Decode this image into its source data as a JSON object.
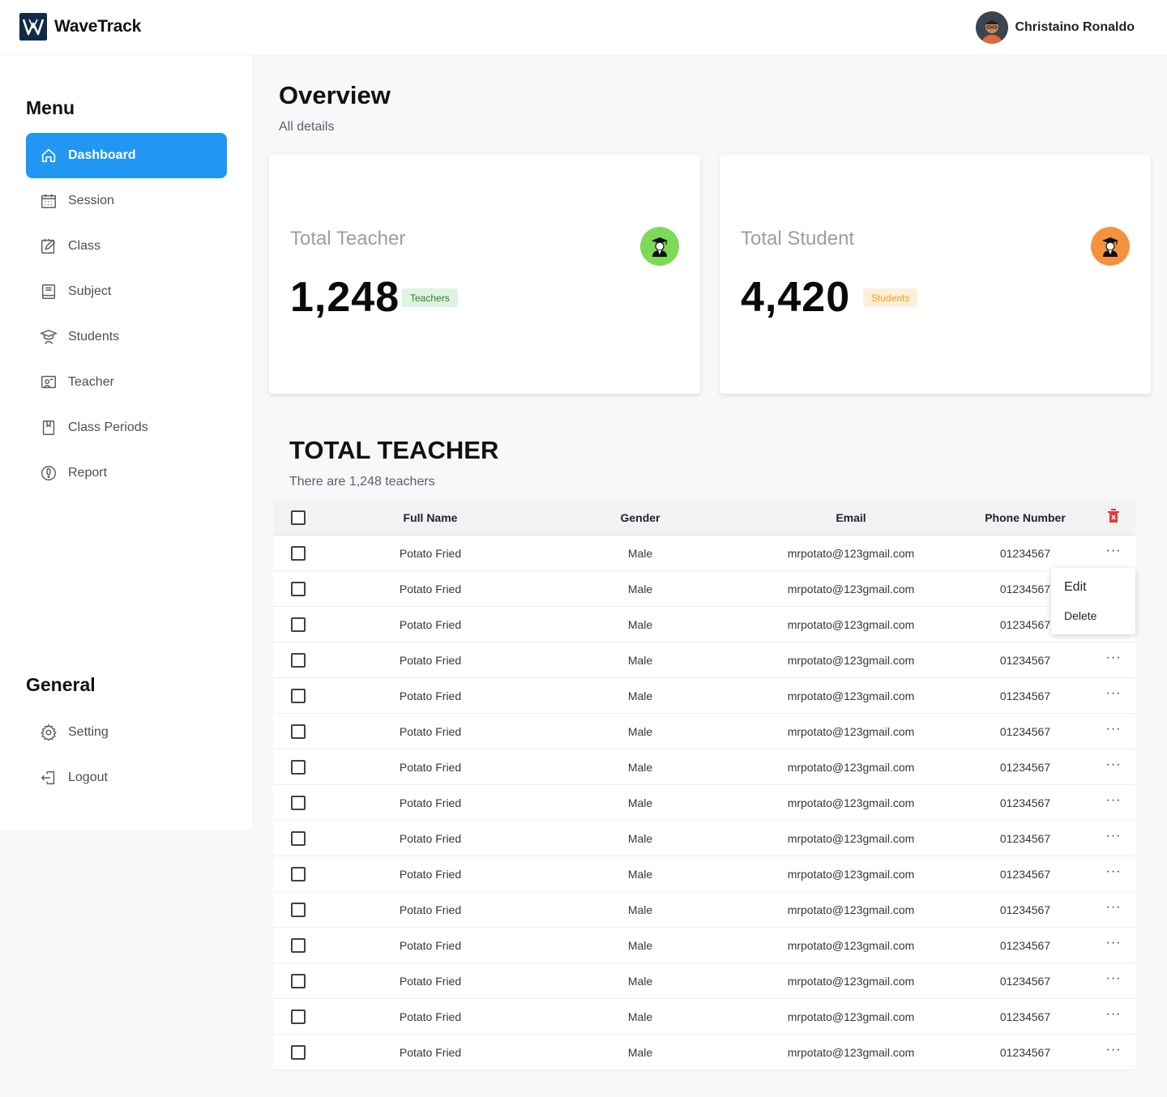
{
  "header": {
    "brand": "WaveTrack",
    "user_name": "Christaino Ronaldo"
  },
  "sidebar": {
    "menu_heading": "Menu",
    "items": [
      {
        "label": "Dashboard",
        "icon": "home-icon",
        "active": true
      },
      {
        "label": "Session",
        "icon": "calendar-icon"
      },
      {
        "label": "Class",
        "icon": "edit-note-icon"
      },
      {
        "label": "Subject",
        "icon": "book-icon"
      },
      {
        "label": "Students",
        "icon": "graduate-icon"
      },
      {
        "label": "Teacher",
        "icon": "teacher-board-icon"
      },
      {
        "label": "Class Periods",
        "icon": "bookmark-icon"
      },
      {
        "label": "Report",
        "icon": "alert-icon"
      }
    ],
    "general_heading": "General",
    "general_items": [
      {
        "label": "Setting",
        "icon": "gear-icon"
      },
      {
        "label": "Logout",
        "icon": "logout-icon"
      }
    ]
  },
  "overview": {
    "title": "Overview",
    "subtitle": "All details"
  },
  "cards": [
    {
      "label": "Total Teacher",
      "value": "1,248",
      "badge": "Teachers",
      "badge_bg": "#dff3e1",
      "badge_color": "#2e7d32",
      "icon_bg": "#7ed957"
    },
    {
      "label": "Total Student",
      "value": "4,420",
      "badge": "Students",
      "badge_bg": "#fdf0d7",
      "badge_color": "#f0a020",
      "icon_bg": "#f5923e"
    }
  ],
  "teacher_table": {
    "title": "TOTAL TEACHER",
    "subtitle": "There are 1,248 teachers",
    "columns": [
      "Full Name",
      "Gender",
      "Email",
      "Phone Number"
    ],
    "rows": [
      {
        "name": "Potato Fried",
        "gender": "Male",
        "email": "mrpotato@123gmail.com",
        "phone": "01234567"
      },
      {
        "name": "Potato Fried",
        "gender": "Male",
        "email": "mrpotato@123gmail.com",
        "phone": "01234567"
      },
      {
        "name": "Potato Fried",
        "gender": "Male",
        "email": "mrpotato@123gmail.com",
        "phone": "01234567"
      },
      {
        "name": "Potato Fried",
        "gender": "Male",
        "email": "mrpotato@123gmail.com",
        "phone": "01234567"
      },
      {
        "name": "Potato Fried",
        "gender": "Male",
        "email": "mrpotato@123gmail.com",
        "phone": "01234567"
      },
      {
        "name": "Potato Fried",
        "gender": "Male",
        "email": "mrpotato@123gmail.com",
        "phone": "01234567"
      },
      {
        "name": "Potato Fried",
        "gender": "Male",
        "email": "mrpotato@123gmail.com",
        "phone": "01234567"
      },
      {
        "name": "Potato Fried",
        "gender": "Male",
        "email": "mrpotato@123gmail.com",
        "phone": "01234567"
      },
      {
        "name": "Potato Fried",
        "gender": "Male",
        "email": "mrpotato@123gmail.com",
        "phone": "01234567"
      },
      {
        "name": "Potato Fried",
        "gender": "Male",
        "email": "mrpotato@123gmail.com",
        "phone": "01234567"
      },
      {
        "name": "Potato Fried",
        "gender": "Male",
        "email": "mrpotato@123gmail.com",
        "phone": "01234567"
      },
      {
        "name": "Potato Fried",
        "gender": "Male",
        "email": "mrpotato@123gmail.com",
        "phone": "01234567"
      },
      {
        "name": "Potato Fried",
        "gender": "Male",
        "email": "mrpotato@123gmail.com",
        "phone": "01234567"
      },
      {
        "name": "Potato Fried",
        "gender": "Male",
        "email": "mrpotato@123gmail.com",
        "phone": "01234567"
      },
      {
        "name": "Potato Fried",
        "gender": "Male",
        "email": "mrpotato@123gmail.com",
        "phone": "01234567"
      }
    ],
    "action_menu": {
      "edit": "Edit",
      "delete": "Delete"
    },
    "delete_icon_color": "#e53935"
  },
  "accent": "#2196f3"
}
